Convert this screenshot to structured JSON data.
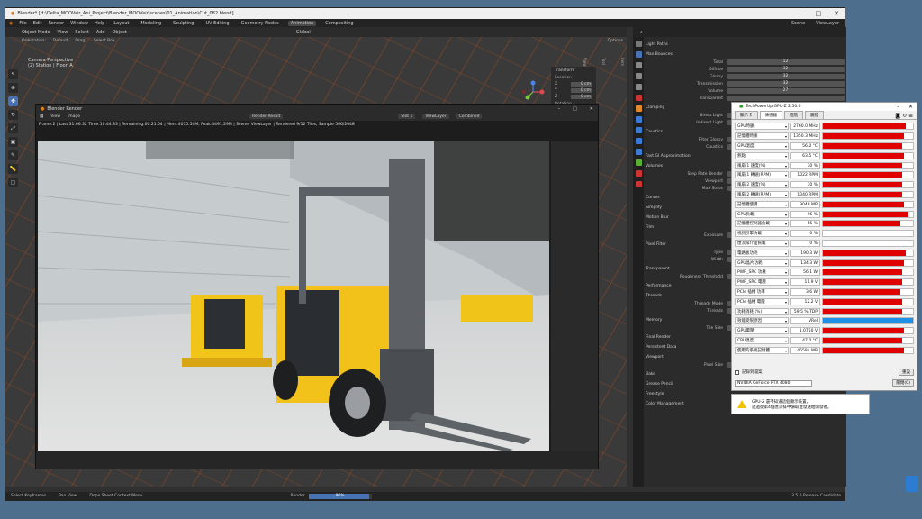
{
  "blender": {
    "title": "Blender* [H:\\Delta_MOOVair_Ani_Project\\Blender_MOOVair\\scenes\\01_Animation\\Cut_082.blend]",
    "menu": [
      "File",
      "Edit",
      "Render",
      "Window",
      "Help"
    ],
    "workspaces": [
      "Layout",
      "Modeling",
      "Sculpting",
      "UV Editing",
      "Geometry Nodes",
      "Animation",
      "Compositing"
    ],
    "active_workspace": "Animation",
    "scene": "Scene",
    "view_layer": "ViewLayer",
    "viewport": {
      "mode": "Object Mode",
      "menus": [
        "View",
        "Select",
        "Add",
        "Object"
      ],
      "orientation_label": "Orientation:",
      "orientation": "Default",
      "drag_label": "Drag:",
      "drag": "Select Box",
      "transform_space": "Global",
      "options": "Options",
      "info_line1": "Camera Perspective",
      "info_line2": "(2) Station | Floor_A",
      "n_panel": {
        "title": "Transform",
        "location": "Location",
        "rows": [
          {
            "axis": "X",
            "value": "0 cm"
          },
          {
            "axis": "Y",
            "value": "0 cm"
          },
          {
            "axis": "Z",
            "value": "0 cm"
          }
        ],
        "rotation": "Rotation"
      },
      "side_tabs": [
        "Item",
        "Tool",
        "View"
      ],
      "dims": [
        "1438 cm",
        "5683 cm",
        "14.3 cm"
      ]
    },
    "render_window": {
      "title": "Blender Render",
      "menus": [
        "View",
        "Image"
      ],
      "result": "Render Result",
      "slot": "Slot 1",
      "layer": "ViewLayer",
      "pass": "Combined",
      "stats": "Frame:2 | Last:31:06.32 Time:10:44.33 | Remaining:00:21.64 | Mem:4075.56M, Peak:4491.29M | Scene, ViewLayer | Rendered 9/12 Tiles, Sample 566/2048",
      "end_label_1": "End",
      "end_value_1": "600",
      "end_label_2": "End",
      "end_value_2": "600",
      "play_label": "Playba",
      "keying_label": "Keying",
      "view_label": "View",
      "marker_label": "Marker"
    },
    "properties": {
      "sections": [
        {
          "type": "section",
          "label": "Light Paths"
        },
        {
          "type": "section",
          "label": "Max Bounces"
        },
        {
          "type": "row",
          "label": "Total",
          "value": "12"
        },
        {
          "type": "row",
          "label": "Diffuse",
          "value": "32"
        },
        {
          "type": "row",
          "label": "Glossy",
          "value": "32"
        },
        {
          "type": "row",
          "label": "Transmission",
          "value": "32"
        },
        {
          "type": "row",
          "label": "Volume",
          "value": "27"
        },
        {
          "type": "row",
          "label": "Transparent",
          "value": ""
        },
        {
          "type": "section",
          "label": "Clamping"
        },
        {
          "type": "row",
          "label": "Direct Light",
          "value": ""
        },
        {
          "type": "row",
          "label": "Indirect Light",
          "value": ""
        },
        {
          "type": "section",
          "label": "Caustics"
        },
        {
          "type": "row",
          "label": "Filter Glossy",
          "value": ""
        },
        {
          "type": "row",
          "label": "Caustics",
          "value": ""
        },
        {
          "type": "section",
          "label": "Fast GI Approximation"
        },
        {
          "type": "section",
          "label": "Volumes"
        },
        {
          "type": "row",
          "label": "Step Rate Render",
          "value": ""
        },
        {
          "type": "row",
          "label": "Viewport",
          "value": ""
        },
        {
          "type": "row",
          "label": "Max Steps",
          "value": ""
        },
        {
          "type": "section",
          "label": "Curves"
        },
        {
          "type": "section",
          "label": "Simplify"
        },
        {
          "type": "section",
          "label": "Motion Blur"
        },
        {
          "type": "section",
          "label": "Film"
        },
        {
          "type": "row",
          "label": "Exposure",
          "value": ""
        },
        {
          "type": "section",
          "label": "Pixel Filter"
        },
        {
          "type": "row",
          "label": "Type",
          "value": "Ga"
        },
        {
          "type": "row",
          "label": "Width",
          "value": ""
        },
        {
          "type": "section",
          "label": "Transparent"
        },
        {
          "type": "row",
          "label": "Roughness Threshold",
          "value": ""
        },
        {
          "type": "section",
          "label": "Performance"
        },
        {
          "type": "section",
          "label": "Threads"
        },
        {
          "type": "row",
          "label": "Threads Mode",
          "value": "Au"
        },
        {
          "type": "row",
          "label": "Threads",
          "value": ""
        },
        {
          "type": "section",
          "label": "Memory"
        },
        {
          "type": "row",
          "label": "Tile Size",
          "value": ""
        },
        {
          "type": "section",
          "label": "Final Render"
        },
        {
          "type": "section",
          "label": "Persistent Data"
        },
        {
          "type": "section",
          "label": "Viewport"
        },
        {
          "type": "row",
          "label": "Pixel Size",
          "value": "Automatic"
        },
        {
          "type": "section",
          "label": "Bake"
        },
        {
          "type": "section",
          "label": "Grease Pencil"
        },
        {
          "type": "section",
          "label": "Freestyle"
        },
        {
          "type": "section",
          "label": "Color Management"
        }
      ]
    },
    "statusbar": {
      "items": [
        "Select Keyframes",
        "Pan View",
        "Dope Sheet Context Menu"
      ],
      "render_label": "Render",
      "render_progress": 0.96,
      "render_progress_text": "96%",
      "version": "3.5.0 Release Candidate"
    }
  },
  "gpuz": {
    "title": "TechPowerUp GPU-Z 2.50.0",
    "tabs": [
      "顯示卡",
      "傳感器",
      "進階",
      "驗證"
    ],
    "active_tab": "傳感器",
    "sensors": [
      {
        "name": "GPU時脈",
        "value": "2760.0 MHz",
        "fill": 0.92,
        "color": "#e00000"
      },
      {
        "name": "記憶體時脈",
        "value": "1350.3 MHz",
        "fill": 0.9,
        "color": "#e00000"
      },
      {
        "name": "GPU溫度",
        "value": "56.0 °C",
        "fill": 0.88,
        "color": "#e00000"
      },
      {
        "name": "熱點",
        "value": "63.5 °C",
        "fill": 0.9,
        "color": "#e00000"
      },
      {
        "name": "風扇 1 速度(%)",
        "value": "30 %",
        "fill": 0.88,
        "color": "#e00000"
      },
      {
        "name": "風扇 1 轉速(RPM)",
        "value": "1022 RPM",
        "fill": 0.88,
        "color": "#e00000"
      },
      {
        "name": "風扇 2 速度(%)",
        "value": "30 %",
        "fill": 0.88,
        "color": "#e00000"
      },
      {
        "name": "風扇 2 轉速(RPM)",
        "value": "1040 RPM",
        "fill": 0.88,
        "color": "#e00000"
      },
      {
        "name": "記憶體使用",
        "value": "9048 MB",
        "fill": 0.9,
        "color": "#e00000"
      },
      {
        "name": "GPU負載",
        "value": "96 %",
        "fill": 0.95,
        "color": "#e00000"
      },
      {
        "name": "記憶體控制器負載",
        "value": "55 %",
        "fill": 0.86,
        "color": "#e00000"
      },
      {
        "name": "視訊引擎負載",
        "value": "0 %",
        "fill": 0.0,
        "color": "#e00000"
      },
      {
        "name": "匯流排介面負載",
        "value": "0 %",
        "fill": 0.0,
        "color": "#e00000"
      },
      {
        "name": "電路板功耗",
        "value": "190.3 W",
        "fill": 0.92,
        "color": "#e00000"
      },
      {
        "name": "GPU晶片功耗",
        "value": "134.3 W",
        "fill": 0.9,
        "color": "#e00000"
      },
      {
        "name": "PWR_SRC 功耗",
        "value": "56.1 W",
        "fill": 0.88,
        "color": "#e00000"
      },
      {
        "name": "PWR_SRC 電壓",
        "value": "11.9 V",
        "fill": 0.88,
        "color": "#e00000"
      },
      {
        "name": "PCIe 插槽 功率",
        "value": "3.6 W",
        "fill": 0.86,
        "color": "#e00000"
      },
      {
        "name": "PCIe 插槽 電壓",
        "value": "12.2 V",
        "fill": 0.88,
        "color": "#e00000"
      },
      {
        "name": "功耗消耗 (%)",
        "value": "59.5 % TDP",
        "fill": 0.88,
        "color": "#e00000"
      },
      {
        "name": "效能受限原因",
        "value": "VRel",
        "fill": 1.0,
        "color": "#1e90e8"
      },
      {
        "name": "GPU電壓",
        "value": "1.0750 V",
        "fill": 0.9,
        "color": "#e00000"
      },
      {
        "name": "CPU溫度",
        "value": "47.0 °C",
        "fill": 0.88,
        "color": "#e00000"
      },
      {
        "name": "使用的系統記憶體",
        "value": "45584 MB",
        "fill": 0.9,
        "color": "#e00000"
      }
    ],
    "log_label": "記錄到檔案",
    "reset_label": "重設",
    "gpu_name": "NVIDIA GeForce RTX 4080",
    "close_label": "關閉(C)",
    "notice_line1": "GPU-Z 還不知道這個顯示裝置，",
    "notice_line2": "過過從第4個匯流排中讀取並發送給開發者。"
  }
}
